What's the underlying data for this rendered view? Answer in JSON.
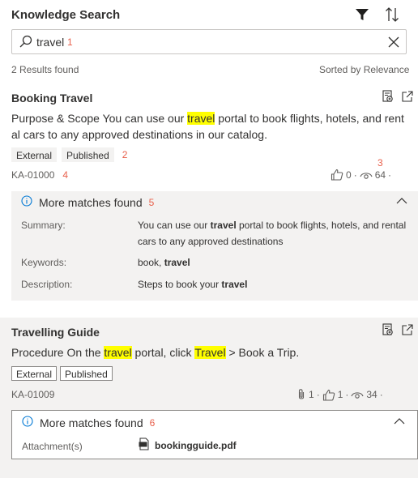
{
  "header": {
    "title": "Knowledge Search",
    "filter_icon": "filter-icon",
    "sort_icon": "sort-icon"
  },
  "search": {
    "value": "travel",
    "placeholder": "",
    "callout": "1"
  },
  "results_summary": {
    "count_text": "2 Results found",
    "sort_text": "Sorted by Relevance"
  },
  "articles": [
    {
      "title": "Booking Travel",
      "body_parts": [
        "Purpose & Scope You can use our ",
        "travel",
        " portal to book flights, hotels, and rent al cars to any approved destinations in our catalog."
      ],
      "tags": [
        "External",
        "Published"
      ],
      "tags_callout": "2",
      "id": "KA-01000",
      "id_callout": "4",
      "likes": "0",
      "views": "64",
      "stats_callout": "3",
      "matches": {
        "heading": "More matches found",
        "callout": "5",
        "summary_label": "Summary:",
        "summary_parts": [
          "You can use our ",
          "travel",
          " portal to book flights, hotels, and rental cars to any approved destinations"
        ],
        "keywords_label": "Keywords:",
        "keywords_parts": [
          "book, ",
          "travel"
        ],
        "description_label": "Description:",
        "description_parts": [
          "Steps to book your ",
          "travel"
        ]
      }
    },
    {
      "title": "Travelling Guide",
      "body_parts": [
        "Procedure On the ",
        "travel",
        " portal, click ",
        "Travel",
        " > Book a Trip."
      ],
      "tags": [
        "External",
        "Published"
      ],
      "id": "KA-01009",
      "attachments": "1",
      "likes": "1",
      "views": "34",
      "matches": {
        "heading": "More matches found",
        "callout": "6",
        "attachment_label": "Attachment(s)",
        "attachment_name": "bookingguide.pdf"
      }
    }
  ],
  "colors": {
    "highlight": "#ffff00",
    "callout": "#e8604c",
    "panel_bg": "#f3f2f1",
    "info_blue": "#0078d4"
  }
}
